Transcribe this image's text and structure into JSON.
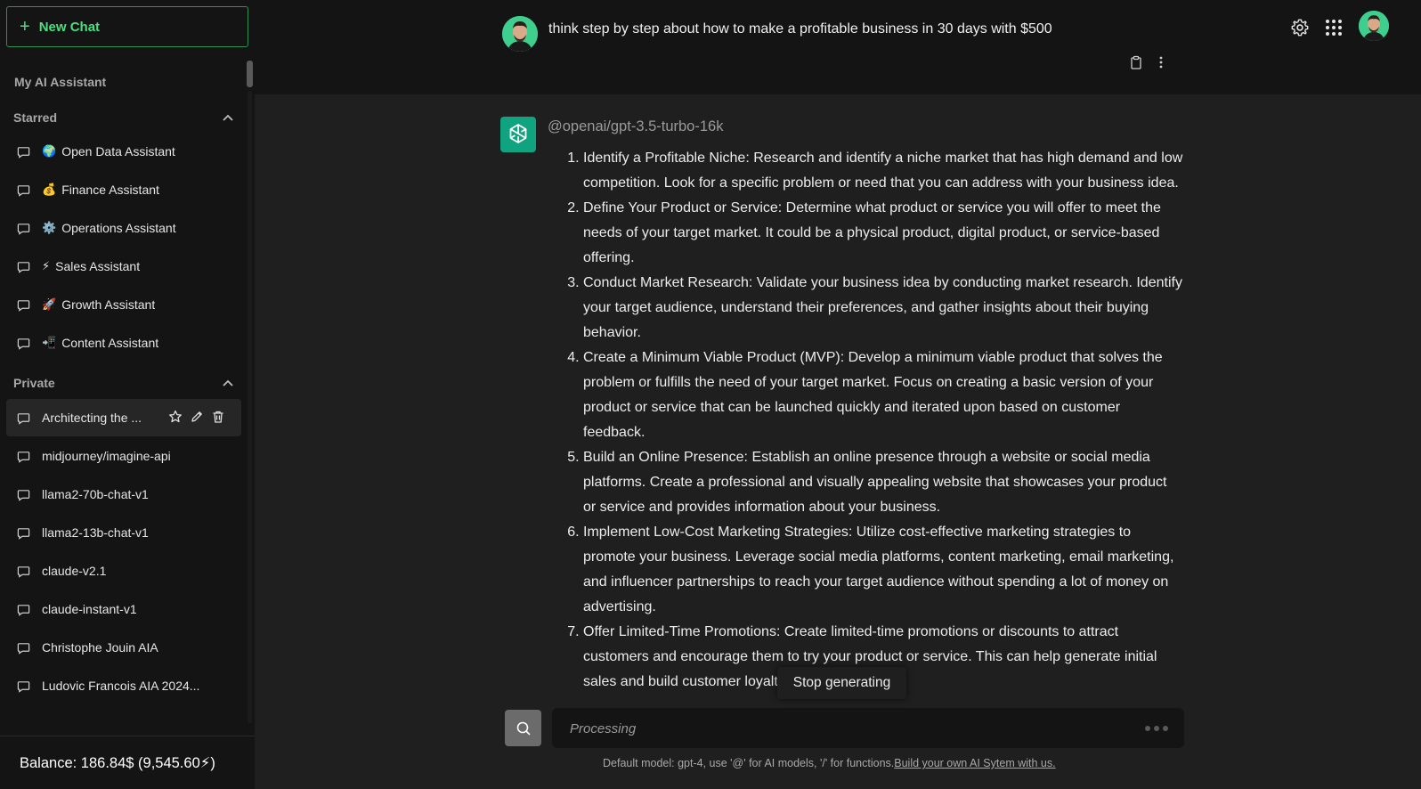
{
  "sidebar": {
    "new_chat_label": "New Chat",
    "my_ai_label": "My AI Assistant",
    "starred": {
      "label": "Starred",
      "items": [
        {
          "emoji": "🌍",
          "label": "Open Data Assistant"
        },
        {
          "emoji": "💰",
          "label": "Finance Assistant"
        },
        {
          "emoji": "⚙️",
          "label": "Operations Assistant"
        },
        {
          "emoji": "⚡",
          "label": "Sales Assistant"
        },
        {
          "emoji": "🚀",
          "label": "Growth Assistant"
        },
        {
          "emoji": "📲",
          "label": "Content Assistant"
        }
      ]
    },
    "private": {
      "label": "Private",
      "items": [
        {
          "label": "Architecting the ..."
        },
        {
          "label": "midjourney/imagine-api"
        },
        {
          "label": "llama2-70b-chat-v1"
        },
        {
          "label": "llama2-13b-chat-v1"
        },
        {
          "label": "claude-v2.1"
        },
        {
          "label": "claude-instant-v1"
        },
        {
          "label": "Christophe Jouin AIA"
        },
        {
          "label": "Ludovic Francois AIA 2024..."
        }
      ]
    },
    "balance": "Balance: 186.84$ (9,545.60⚡)"
  },
  "header": {
    "title": "think step by step about how to make a profitable business in 30 days with $500"
  },
  "message": {
    "model": "@openai/gpt-3.5-turbo-16k",
    "steps": [
      "Identify a Profitable Niche: Research and identify a niche market that has high demand and low competition. Look for a specific problem or need that you can address with your business idea.",
      "Define Your Product or Service: Determine what product or service you will offer to meet the needs of your target market. It could be a physical product, digital product, or service-based offering.",
      "Conduct Market Research: Validate your business idea by conducting market research. Identify your target audience, understand their preferences, and gather insights about their buying behavior.",
      "Create a Minimum Viable Product (MVP): Develop a minimum viable product that solves the problem or fulfills the need of your target market. Focus on creating a basic version of your product or service that can be launched quickly and iterated upon based on customer feedback.",
      "Build an Online Presence: Establish an online presence through a website or social media platforms. Create a professional and visually appealing website that showcases your product or service and provides information about your business.",
      "Implement Low-Cost Marketing Strategies: Utilize cost-effective marketing strategies to promote your business. Leverage social media platforms, content marketing, email marketing, and influencer partnerships to reach your target audience without spending a lot of money on advertising.",
      "Offer Limited-Time Promotions: Create limited-time promotions or discounts to attract customers and encourage them to try your product or service. This can help generate initial sales and build customer loyalty."
    ]
  },
  "stop_label": "Stop generating",
  "input": {
    "placeholder": "Processing"
  },
  "footer": {
    "text": "Default model: gpt-4, use '@' for AI models, '/' for functions.",
    "link": "Build your own AI Sytem with us."
  }
}
